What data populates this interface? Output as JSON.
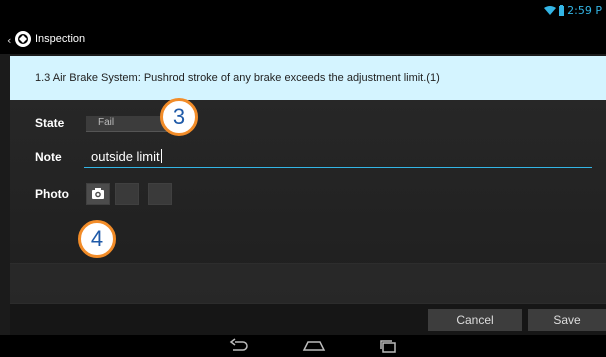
{
  "status": {
    "time": "2:59 P"
  },
  "actionbar": {
    "back": "‹",
    "title": "Inspection",
    "logo_icon": "inspection-logo-icon"
  },
  "banner": {
    "text": "1.3 Air Brake System: Pushrod stroke of any brake exceeds the adjustment limit.(1)"
  },
  "form": {
    "state_label": "State",
    "state_value": "Fail",
    "note_label": "Note",
    "note_value": "outside limit",
    "photo_label": "Photo"
  },
  "callouts": [
    "3",
    "4"
  ],
  "buttons": {
    "cancel": "Cancel",
    "save": "Save"
  },
  "colors": {
    "accent": "#33b5e5",
    "banner": "#d4f4ff",
    "callout_ring": "#f28c28",
    "callout_text": "#1f5aa8"
  }
}
